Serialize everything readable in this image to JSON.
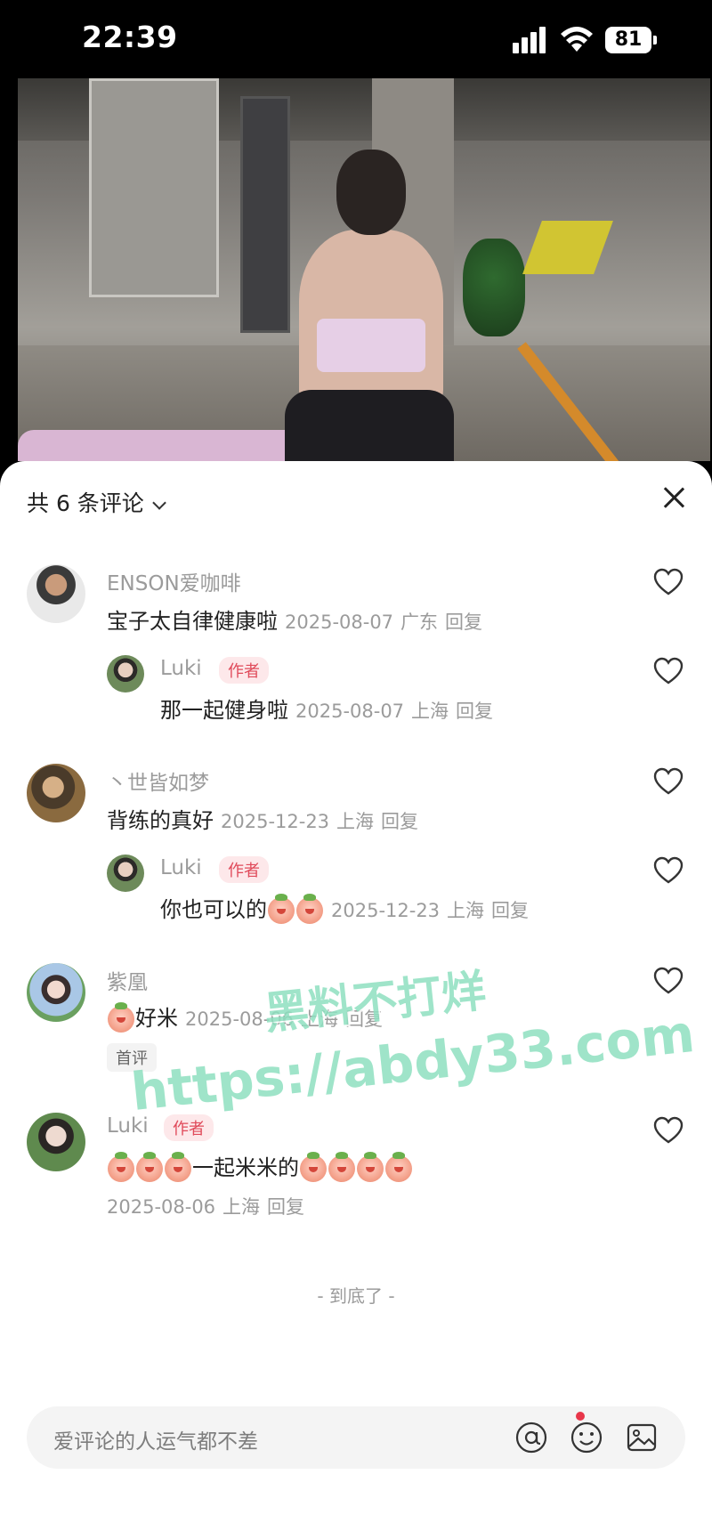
{
  "status_bar": {
    "time": "22:39",
    "battery": "81"
  },
  "sheet": {
    "header_title": "共 6 条评论",
    "end_text": "- 到底了 -",
    "input_placeholder": "爱评论的人运气都不差"
  },
  "comments": [
    {
      "user": "ENSON爱咖啡",
      "text": "宝子太自律健康啦",
      "date": "2025-08-07",
      "location": "广东",
      "reply_label": "回复"
    },
    {
      "user": "Luki",
      "badge": "作者",
      "text": "那一起健身啦",
      "date": "2025-08-07",
      "location": "上海",
      "reply_label": "回复"
    },
    {
      "user": "丶世皆如梦",
      "text": "背练的真好",
      "date": "2025-12-23",
      "location": "上海",
      "reply_label": "回复"
    },
    {
      "user": "Luki",
      "badge": "作者",
      "text": "你也可以的",
      "date": "2025-12-23",
      "location": "上海",
      "reply_label": "回复"
    },
    {
      "user": "紫凰",
      "text": "好米",
      "date": "2025-08-06",
      "location": "上海",
      "reply_label": "回复",
      "tag": "首评"
    },
    {
      "user": "Luki",
      "badge": "作者",
      "text": "一起米米的",
      "date": "2025-08-06",
      "location": "上海",
      "reply_label": "回复"
    }
  ],
  "watermark": {
    "line1": "黑料不打烊",
    "line2": "https://abdy33.com"
  },
  "icons": {
    "close": "close-icon",
    "like": "heart-icon",
    "mention": "at-icon",
    "emoji": "emoji-icon",
    "image": "image-icon"
  },
  "colors": {
    "author_badge_bg": "#fde8ea",
    "author_badge_text": "#e04a5a",
    "notification_dot": "#e8364a",
    "watermark": "#8fe0c0"
  }
}
